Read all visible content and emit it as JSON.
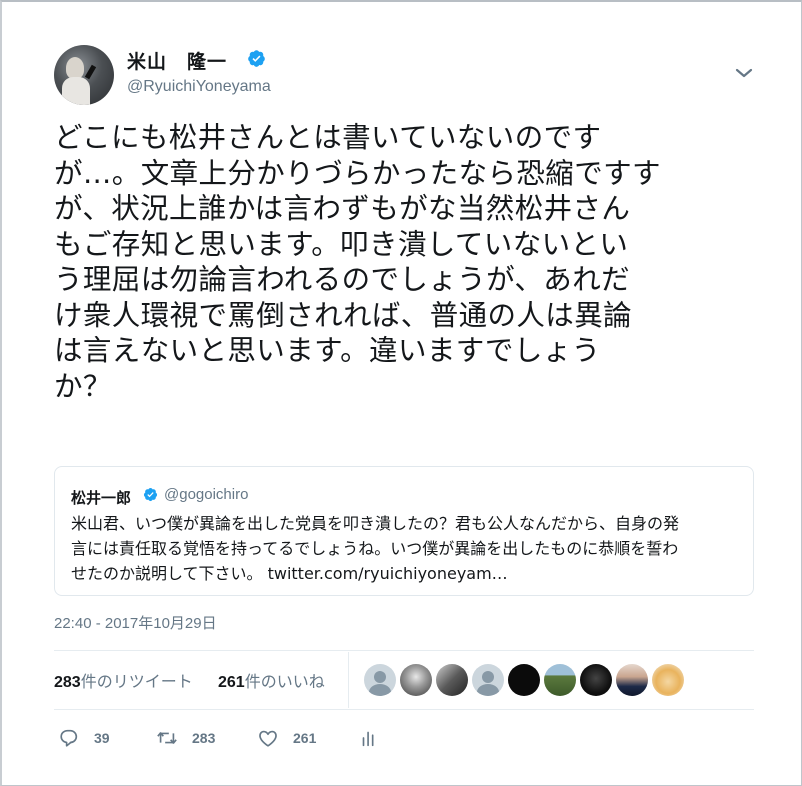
{
  "author": {
    "name": "米山　隆一",
    "handle": "@RyuichiYoneyama",
    "verified": true
  },
  "tweet": {
    "lines": [
      "どこにも松井さんとは書いていないのです",
      "が…。文章上分かりづらかったなら恐縮ですす",
      "が、状況上誰かは言わずもがな当然松井さん",
      "もご存知と思います。叩き潰していないとい",
      "う理屈は勿論言われるのでしょうが、あれだ",
      "け衆人環視で罵倒されれば、普通の人は異論",
      "は言えないと思います。違いますでしょう",
      "か？"
    ]
  },
  "quote": {
    "name": "松井一郎",
    "handle": "@gogoichiro",
    "verified": true,
    "lines": [
      "米山君、いつ僕が異論を出した党員を叩き潰したの？君も公人なんだから、自身の発",
      "言には責任取る覚悟を持ってるでしょうね。いつ僕が異論を出したものに恭順を誓わ",
      "せたのか説明して下さい。 twitter.com/ryuichiyoneyam…"
    ]
  },
  "timestamp": "22:40 - 2017年10月29日",
  "stats": {
    "retweets_count": "283",
    "retweets_label": "件のリツイート",
    "likes_count": "261",
    "likes_label": "件のいいね"
  },
  "actions": {
    "reply_count": "39",
    "retweet_count": "283",
    "like_count": "261"
  },
  "colors": {
    "verified": "#1da1f2",
    "secondary_text": "#657786",
    "border": "#e1e8ed"
  },
  "icons": [
    "verified-badge-icon",
    "chevron-down-icon",
    "reply-icon",
    "retweet-icon",
    "heart-icon",
    "analytics-icon"
  ]
}
